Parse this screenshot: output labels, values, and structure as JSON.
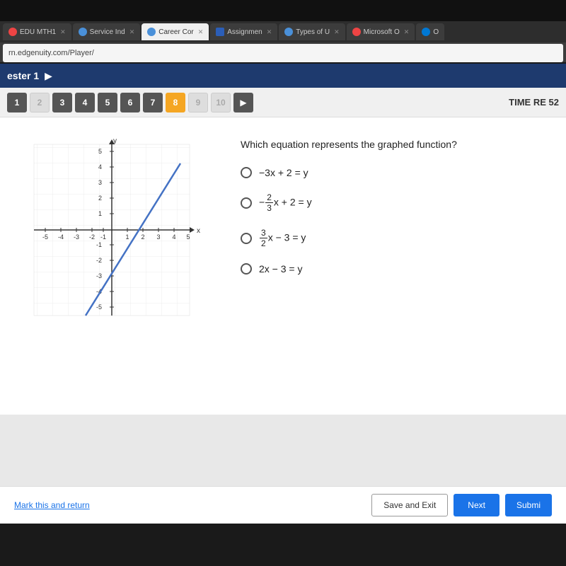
{
  "browser": {
    "address": "rn.edgenuity.com/Player/",
    "tabs": [
      {
        "label": "EDU MTH1",
        "icon": "edgenuity",
        "active": false
      },
      {
        "label": "Service Ind",
        "icon": "service",
        "active": false
      },
      {
        "label": "Career Cor",
        "icon": "career",
        "active": true
      },
      {
        "label": "Assignmen",
        "icon": "word",
        "active": false
      },
      {
        "label": "Types of U",
        "icon": "types",
        "active": false
      },
      {
        "label": "Microsoft O",
        "icon": "microsoft",
        "active": false
      },
      {
        "label": "O",
        "icon": "outlook",
        "active": false
      }
    ]
  },
  "navbar": {
    "title": "ester 1"
  },
  "timer": {
    "label": "TIME RE",
    "value": "52"
  },
  "questions": {
    "numbers": [
      1,
      2,
      3,
      4,
      5,
      6,
      7,
      8,
      9,
      10
    ],
    "active": 8,
    "completed": [
      3,
      4,
      5,
      6,
      7
    ]
  },
  "question": {
    "text": "Which equation represents the graphed function?",
    "options": [
      {
        "id": "a",
        "text": "-3x + 2 = y"
      },
      {
        "id": "b",
        "text_parts": [
          "fraction",
          "2/3",
          "x + 2 = y"
        ]
      },
      {
        "id": "c",
        "text_parts": [
          "fraction",
          "3/2",
          "x − 3 = y"
        ]
      },
      {
        "id": "d",
        "text": "2x − 3 = y"
      }
    ]
  },
  "bottom": {
    "mark_link": "Mark this and return",
    "save_button": "Save and Exit",
    "next_button": "Next",
    "submit_button": "Submi"
  }
}
